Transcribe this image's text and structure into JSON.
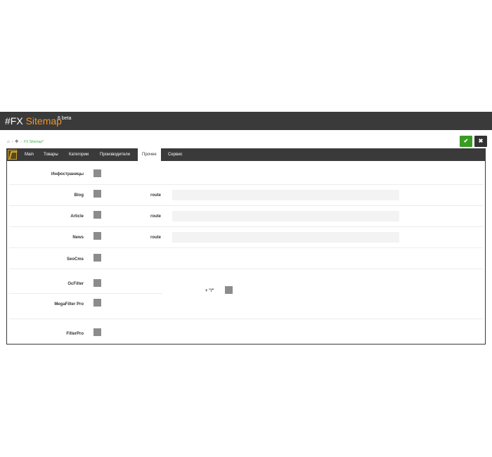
{
  "header": {
    "title_hash": "#FX",
    "title_brand": "Sitemap",
    "version": "6 beta"
  },
  "breadcrumb": {
    "home_icon": "home-icon",
    "module_icon": "puzzle-icon",
    "separator": "›",
    "current": "FX Sitemap*"
  },
  "actions": {
    "save_icon": "✔",
    "close_icon": "✖"
  },
  "tabs": [
    {
      "label": "Main"
    },
    {
      "label": "Товары"
    },
    {
      "label": "Категории"
    },
    {
      "label": "Производители"
    },
    {
      "label": "Прочее"
    },
    {
      "label": "Сервис"
    }
  ],
  "active_tab": "Прочее",
  "rows": {
    "infopages": {
      "label": "Инфостраницы"
    },
    "blog": {
      "label": "Blog",
      "route_label": "route",
      "route_value": ""
    },
    "article": {
      "label": "Article",
      "route_label": "route",
      "route_value": ""
    },
    "news": {
      "label": "News",
      "route_label": "route",
      "route_value": ""
    },
    "seocms": {
      "label": "SeoCms"
    },
    "ocfilter": {
      "label": "OcFilter"
    },
    "megafilter": {
      "label": "MegaFilter Pro"
    },
    "filterpro": {
      "label": "FilterPro"
    },
    "slash": {
      "label": "+ \"/\""
    }
  },
  "colors": {
    "header_bg": "#3a3a3a",
    "brand": "#f0932b",
    "save_button": "#3a9d23",
    "checkbox": "#8c8c8c"
  }
}
